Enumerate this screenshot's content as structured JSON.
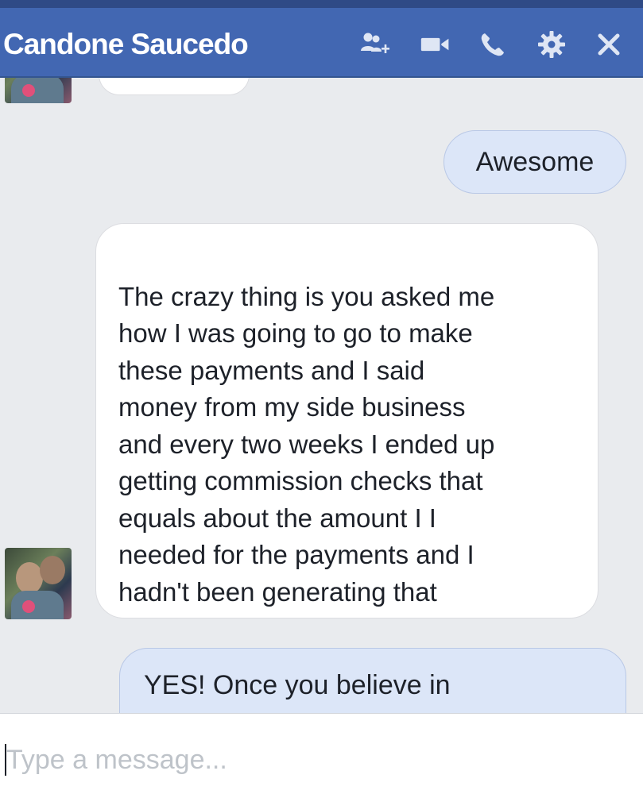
{
  "header": {
    "title": "Candone Saucedo",
    "icons": [
      "add-person-icon",
      "video-camera-icon",
      "phone-icon",
      "gear-icon",
      "close-icon"
    ],
    "background": "#4267b2"
  },
  "messages": [
    {
      "id": "m1",
      "direction": "incoming",
      "text": ""
    },
    {
      "id": "m2",
      "direction": "outgoing",
      "text": "Awesome"
    },
    {
      "id": "m3",
      "direction": "incoming",
      "text": " The crazy thing is you asked me\nhow I was going to go to make\nthese payments and I said\nmoney from my side business\nand every two weeks I ended up\ngetting commission checks that\nequals about the amount I I\nneeded for the payments and I\nhadn't been generating that\nmuch money consistently before"
    },
    {
      "id": "m4",
      "direction": "outgoing",
      "text": "YES! Once you believe in"
    }
  ],
  "composer": {
    "placeholder": "Type a message..."
  },
  "colors": {
    "incoming_bubble": "#ffffff",
    "outgoing_bubble": "#dce6f8",
    "chat_background": "#e9ebee"
  }
}
